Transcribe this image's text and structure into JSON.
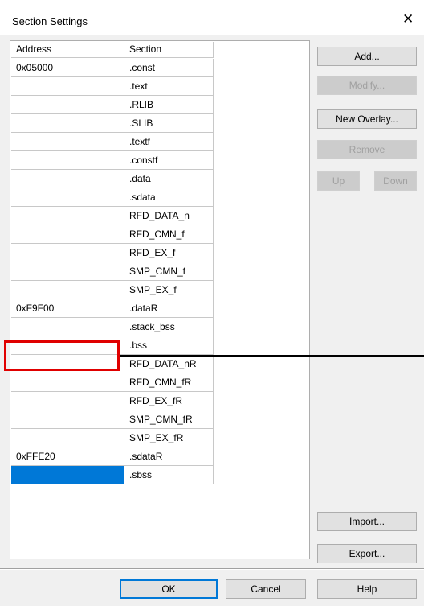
{
  "dialog": {
    "title": "Section Settings",
    "close_glyph": "✕"
  },
  "table": {
    "columns": [
      "Address",
      "Section"
    ],
    "rows": [
      {
        "address": "0x05000",
        "section": ".const"
      },
      {
        "address": "",
        "section": ".text"
      },
      {
        "address": "",
        "section": ".RLIB"
      },
      {
        "address": "",
        "section": ".SLIB"
      },
      {
        "address": "",
        "section": ".textf"
      },
      {
        "address": "",
        "section": ".constf"
      },
      {
        "address": "",
        "section": ".data"
      },
      {
        "address": "",
        "section": ".sdata"
      },
      {
        "address": "",
        "section": "RFD_DATA_n"
      },
      {
        "address": "",
        "section": "RFD_CMN_f"
      },
      {
        "address": "",
        "section": "RFD_EX_f"
      },
      {
        "address": "",
        "section": "SMP_CMN_f"
      },
      {
        "address": "",
        "section": "SMP_EX_f"
      },
      {
        "address": "0xF9F00",
        "section": ".dataR"
      },
      {
        "address": "",
        "section": ".stack_bss"
      },
      {
        "address": "",
        "section": ".bss"
      },
      {
        "address": "",
        "section": "RFD_DATA_nR"
      },
      {
        "address": "",
        "section": "RFD_CMN_fR"
      },
      {
        "address": "",
        "section": "RFD_EX_fR"
      },
      {
        "address": "",
        "section": "SMP_CMN_fR"
      },
      {
        "address": "",
        "section": "SMP_EX_fR"
      },
      {
        "address": "0xFFE20",
        "section": ".sdataR"
      },
      {
        "address": "",
        "section": ".sbss"
      }
    ],
    "selected_row": 22
  },
  "side_buttons": {
    "add": "Add...",
    "modify": "Modify...",
    "new_overlay": "New Overlay...",
    "remove": "Remove",
    "up": "Up",
    "down": "Down",
    "import": "Import...",
    "export": "Export..."
  },
  "footer_buttons": {
    "ok": "OK",
    "cancel": "Cancel",
    "help": "Help"
  },
  "colors": {
    "selection": "#0078d7",
    "annotation_box": "#e00000"
  }
}
